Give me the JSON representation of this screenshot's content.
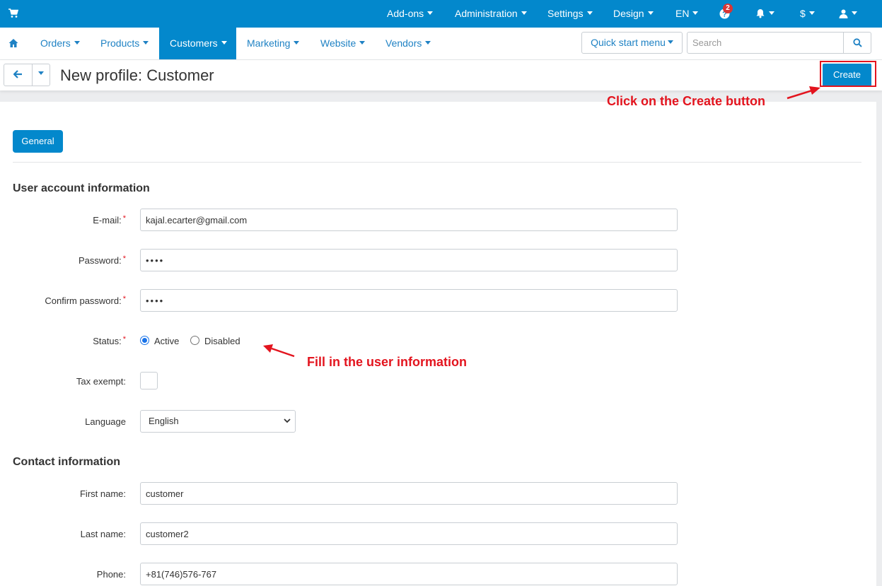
{
  "topbar": {
    "items": [
      "Add-ons",
      "Administration",
      "Settings",
      "Design",
      "EN"
    ],
    "notification_count": "2",
    "currency": "$"
  },
  "nav": {
    "items": [
      "Orders",
      "Products",
      "Customers",
      "Marketing",
      "Website",
      "Vendors"
    ],
    "active": "Customers",
    "quick_start": "Quick start menu",
    "search_placeholder": "Search"
  },
  "header": {
    "title": "New profile: Customer",
    "create_label": "Create"
  },
  "tabs": {
    "general": "General"
  },
  "account": {
    "section_title": "User account information",
    "email_label": "E-mail:",
    "email_value": "kajal.ecarter@gmail.com",
    "password_label": "Password:",
    "password_value": "••••",
    "confirm_label": "Confirm password:",
    "confirm_value": "••••",
    "status_label": "Status:",
    "status_active": "Active",
    "status_disabled": "Disabled",
    "tax_label": "Tax exempt:",
    "language_label": "Language",
    "language_value": "English"
  },
  "contact": {
    "section_title": "Contact information",
    "first_label": "First name:",
    "first_value": "customer",
    "last_label": "Last name:",
    "last_value": "customer2",
    "phone_label": "Phone:",
    "phone_value": "+81(746)576-767"
  },
  "annotations": {
    "create_note": "Click on the Create button",
    "fill_note": "Fill in the user information"
  },
  "colors": {
    "brand": "#0388cc",
    "link": "#1f82c4",
    "annotation": "#e3141e"
  }
}
